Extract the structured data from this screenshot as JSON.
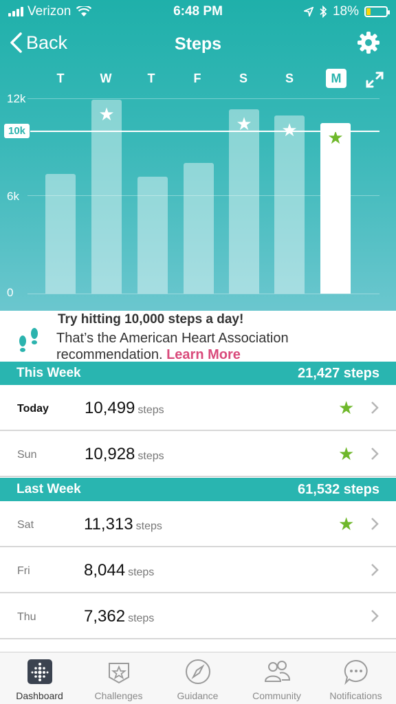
{
  "status": {
    "carrier": "Verizon",
    "time": "6:48 PM",
    "battery": "18%"
  },
  "nav": {
    "back_label": "Back",
    "title": "Steps"
  },
  "chart_data": {
    "type": "bar",
    "categories": [
      "T",
      "W",
      "T",
      "F",
      "S",
      "S",
      "M"
    ],
    "values": [
      7362,
      11900,
      7200,
      8044,
      11313,
      10928,
      10499
    ],
    "goal": 10000,
    "goal_label": "10k",
    "goal_met": [
      false,
      true,
      false,
      false,
      true,
      true,
      true
    ],
    "selected_index": 6,
    "ytick_labels": [
      "12k",
      "6k",
      "0"
    ],
    "ylim": [
      0,
      12000
    ],
    "grid": true
  },
  "tip": {
    "headline": "Try hitting 10,000 steps a day!",
    "body": "That’s the American Heart Association recommendation.",
    "link": "Learn More"
  },
  "this_week": {
    "label": "This Week",
    "total": "21,427 steps",
    "rows": [
      {
        "day": "Today",
        "steps": "10,499",
        "unit": "steps",
        "star": true
      },
      {
        "day": "Sun",
        "steps": "10,928",
        "unit": "steps",
        "star": true
      }
    ]
  },
  "last_week": {
    "label": "Last Week",
    "total": "61,532 steps",
    "rows": [
      {
        "day": "Sat",
        "steps": "11,313",
        "unit": "steps",
        "star": true
      },
      {
        "day": "Fri",
        "steps": "8,044",
        "unit": "steps",
        "star": false
      },
      {
        "day": "Thu",
        "steps": "7,362",
        "unit": "steps",
        "star": false
      }
    ]
  },
  "tabs": [
    {
      "label": "Dashboard",
      "icon": "dashboard-icon"
    },
    {
      "label": "Challenges",
      "icon": "challenges-icon"
    },
    {
      "label": "Guidance",
      "icon": "compass-icon"
    },
    {
      "label": "Community",
      "icon": "community-icon"
    },
    {
      "label": "Notifications",
      "icon": "notifications-icon"
    }
  ],
  "colors": {
    "accent": "#29b5b0",
    "star": "#6fb82b",
    "link": "#d94a7b"
  }
}
